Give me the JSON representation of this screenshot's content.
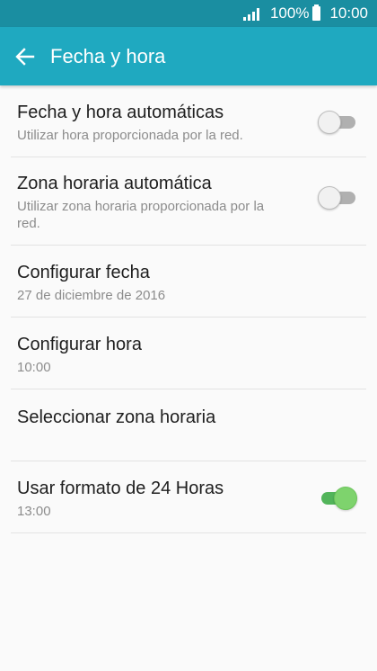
{
  "status_bar": {
    "battery_percent": "100%",
    "time": "10:00"
  },
  "app_bar": {
    "title": "Fecha y hora"
  },
  "settings": [
    {
      "label": "Fecha y hora automáticas",
      "sub": "Utilizar hora proporcionada por la red.",
      "switch": "off"
    },
    {
      "label": "Zona horaria automática",
      "sub": "Utilizar zona horaria proporcionada por la red.",
      "switch": "off"
    },
    {
      "label": "Configurar fecha",
      "sub": "27 de diciembre de 2016"
    },
    {
      "label": "Configurar hora",
      "sub": "10:00"
    },
    {
      "label": "Seleccionar zona horaria",
      "sub": ""
    },
    {
      "label": "Usar formato de 24 Horas",
      "sub": "13:00",
      "switch": "on"
    }
  ],
  "colors": {
    "status_bar": "#1a8ea1",
    "app_bar": "#1fa9c0",
    "switch_on": "#7ed36d"
  }
}
